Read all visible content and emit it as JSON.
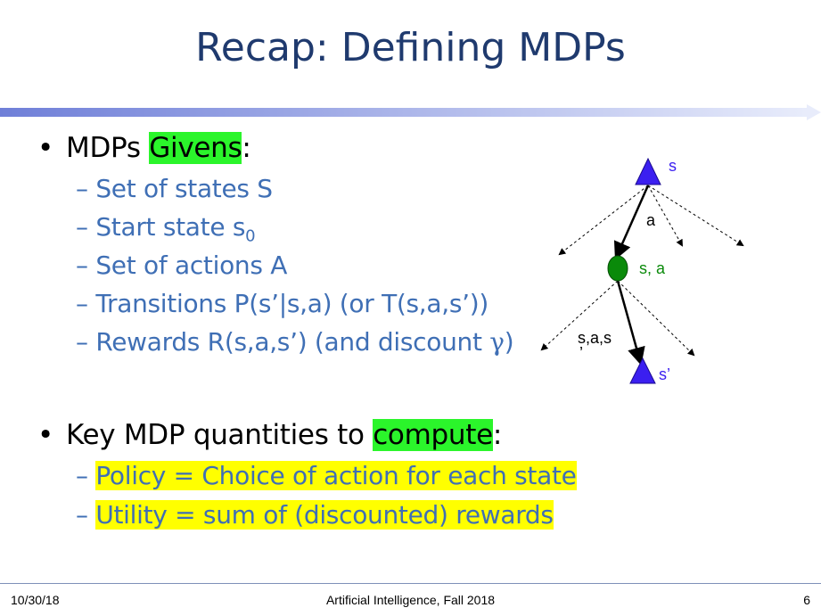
{
  "title": "Recap: Defining MDPs",
  "bullet1": {
    "prefix": "MDPs ",
    "highlight": "Givens",
    "suffix": ":",
    "items": [
      "Set of states S",
      "Start state s",
      "Set of actions A",
      "Transitions P(s’|s,a) (or T(s,a,s’))",
      "Rewards R(s,a,s’) (and discount "
    ],
    "start_subscript": "0",
    "discount_symbol": "γ",
    "discount_close": ")"
  },
  "bullet2": {
    "prefix": "Key MDP quantities to ",
    "highlight": "compute",
    "suffix": ":",
    "items": [
      "Policy = Choice of action for each state",
      "Utility = sum of (discounted) rewards"
    ]
  },
  "diagram": {
    "state_label": "s",
    "action_label": "a",
    "qstate_label": "s, a",
    "transition_label": "s,a,s",
    "transition_prime": "’",
    "next_state_label": "s’",
    "colors": {
      "state": "#3b1ff0",
      "qstate": "#0a8a0a",
      "arrow": "#000000"
    }
  },
  "footer": {
    "date": "10/30/18",
    "course": "Artificial Intelligence, Fall 2018",
    "page": "6"
  }
}
